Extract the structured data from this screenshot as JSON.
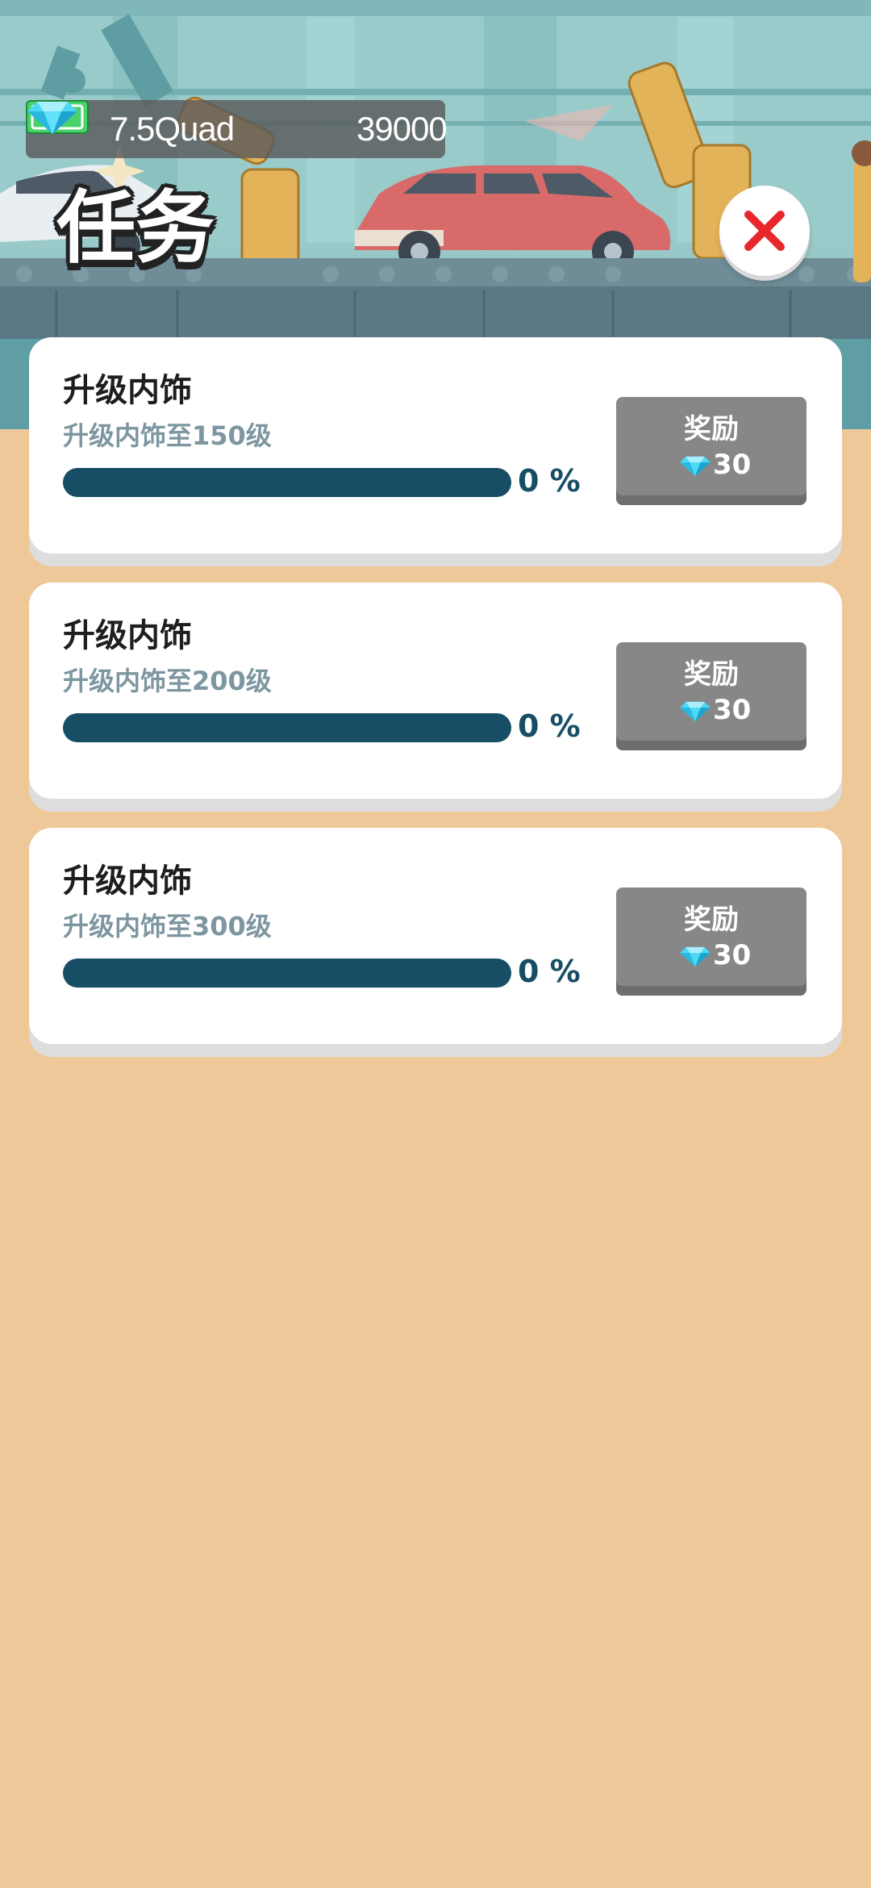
{
  "currency": {
    "cash": "7.5Quad",
    "gems": "39000"
  },
  "page_title": "任务",
  "close_icon": "close-x-icon",
  "tasks": [
    {
      "title": "升级内饰",
      "subtitle": "升级内饰至150级",
      "progress": 0,
      "progress_label": "0 %",
      "reward_label": "奖励",
      "reward_amount": "30"
    },
    {
      "title": "升级内饰",
      "subtitle": "升级内饰至200级",
      "progress": 0,
      "progress_label": "0 %",
      "reward_label": "奖励",
      "reward_amount": "30"
    },
    {
      "title": "升级内饰",
      "subtitle": "升级内饰至300级",
      "progress": 0,
      "progress_label": "0 %",
      "reward_label": "奖励",
      "reward_amount": "30"
    }
  ],
  "colors": {
    "background": "#EFC899",
    "card": "#FFFFFF",
    "progress_track": "#174E66",
    "reward_button": "#878787",
    "close_x": "#E8262B",
    "gem": "#4FD8F5",
    "cash": "#49D26A"
  }
}
